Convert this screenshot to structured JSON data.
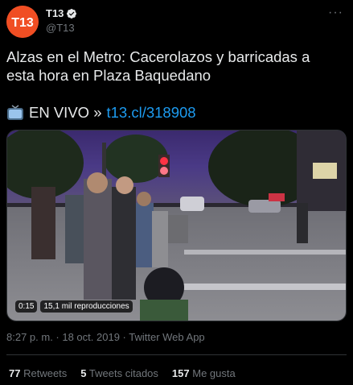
{
  "account": {
    "display_name": "T13",
    "handle": "@T13",
    "avatar_text": "T13",
    "brand_color": "#f04e23"
  },
  "tweet": {
    "text": "Alzas en el Metro: Cacerolazos y barricadas a esta hora en Plaza Baquedano",
    "live_label": "EN VIVO »",
    "link_text": "t13.cl/318908",
    "timestamp": "8:27 p. m. · 18 oct. 2019 · Twitter Web App"
  },
  "video": {
    "duration": "0:15",
    "views": "15,1 mil reproducciones"
  },
  "stats": [
    {
      "count": "77",
      "label": "Retweets"
    },
    {
      "count": "5",
      "label": "Tweets citados"
    },
    {
      "count": "157",
      "label": "Me gusta"
    }
  ],
  "icons": {
    "verified": "verified-badge-icon",
    "more": "more-icon",
    "tv": "tv-icon"
  },
  "colors": {
    "link": "#1d9bf0",
    "background": "#000000",
    "secondary_text": "#71767b"
  }
}
